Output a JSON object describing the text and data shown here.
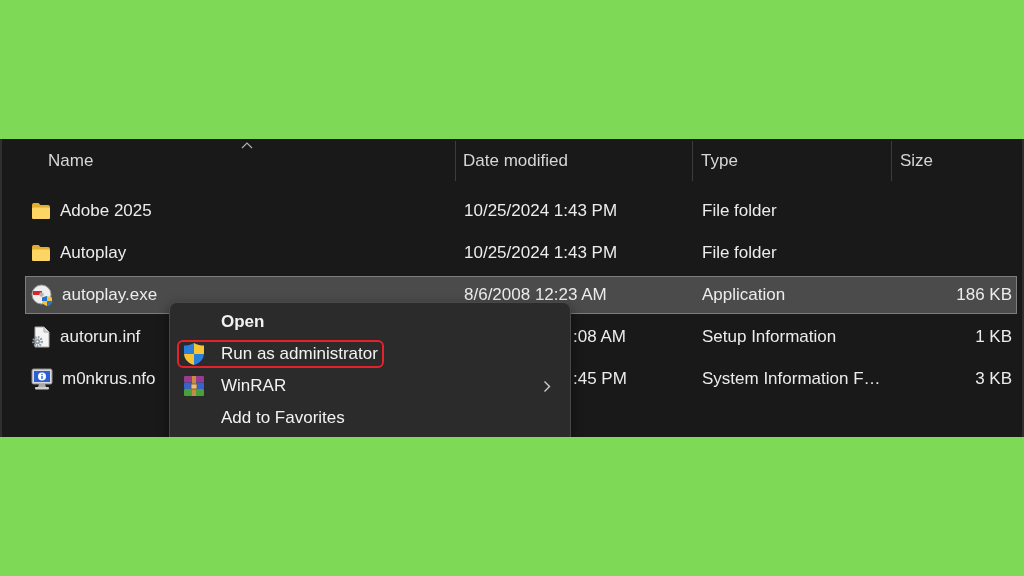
{
  "file_list": {
    "columns": [
      {
        "label": "Name",
        "sorted": true
      },
      {
        "label": "Date modified",
        "sorted": false
      },
      {
        "label": "Type",
        "sorted": false
      },
      {
        "label": "Size",
        "sorted": false
      }
    ],
    "rows": [
      {
        "kind": "folder",
        "name": "Adobe 2025",
        "date_modified": "10/25/2024 1:43 PM",
        "type": "File folder",
        "selected": false
      },
      {
        "kind": "folder",
        "name": "Autoplay",
        "date_modified": "10/25/2024 1:43 PM",
        "type": "File folder",
        "selected": false
      },
      {
        "kind": "application",
        "name": "autoplay.exe",
        "date_modified": "8/6/2008 12:23 AM",
        "type": "Application",
        "size": "186 KB",
        "selected": true
      },
      {
        "kind": "setup_info",
        "name": "autorun.inf",
        "date_modified": ":08 AM",
        "type": "Setup Information",
        "size": "1 KB",
        "selected": false
      },
      {
        "kind": "system_info",
        "name": "m0nkrus.nfo",
        "date_modified": ":45 PM",
        "type": "System Information F…",
        "size": "3 KB",
        "selected": false
      }
    ]
  },
  "context_menu": {
    "items": [
      {
        "kind": "default",
        "label": "Open",
        "highlighted": false,
        "submenu": false
      },
      {
        "kind": "admin",
        "label": "Run as administrator",
        "highlighted": true,
        "submenu": false
      },
      {
        "kind": "archive",
        "label": "WinRAR",
        "highlighted": false,
        "submenu": true
      },
      {
        "kind": "plain",
        "label": "Add to Favorites",
        "highlighted": false,
        "submenu": false
      }
    ]
  }
}
